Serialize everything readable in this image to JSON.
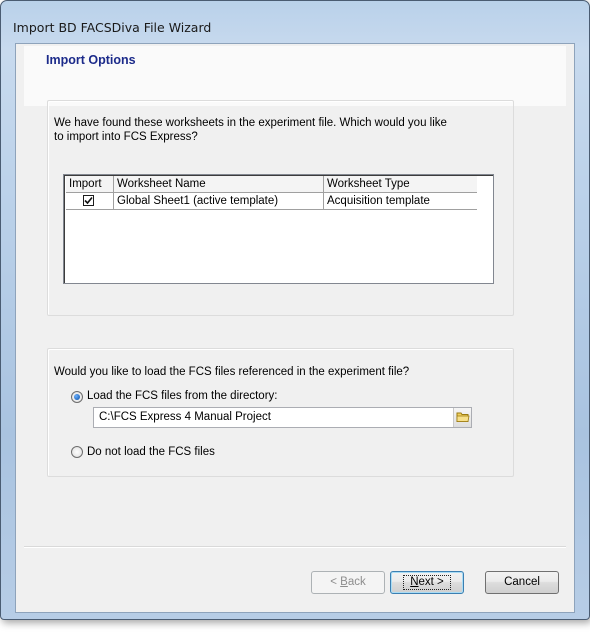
{
  "window": {
    "title": "Import BD FACSDiva File Wizard"
  },
  "header": {
    "title": "Import Options"
  },
  "worksheets": {
    "question": "We have found these worksheets in the experiment file.  Which would you like to import into FCS Express?",
    "columns": [
      "Import",
      "Worksheet Name",
      "Worksheet Type"
    ],
    "rows": [
      {
        "import": true,
        "name": "Global Sheet1 (active template)",
        "type": "Acquisition template"
      }
    ]
  },
  "fcs": {
    "question": "Would you like to load the FCS files referenced in the experiment file?",
    "option_load": "Load the FCS files from the directory:",
    "directory": "C:\\FCS Express 4 Manual Project",
    "option_none": "Do not load the FCS files",
    "selected": "load"
  },
  "buttons": {
    "back_prefix": "< ",
    "back_key": "B",
    "back_rest": "ack",
    "next_key": "N",
    "next_rest": "ext >",
    "cancel": "Cancel"
  },
  "colors": {
    "accent": "#1b2a8a",
    "radio_dot": "#1a5fb4"
  }
}
